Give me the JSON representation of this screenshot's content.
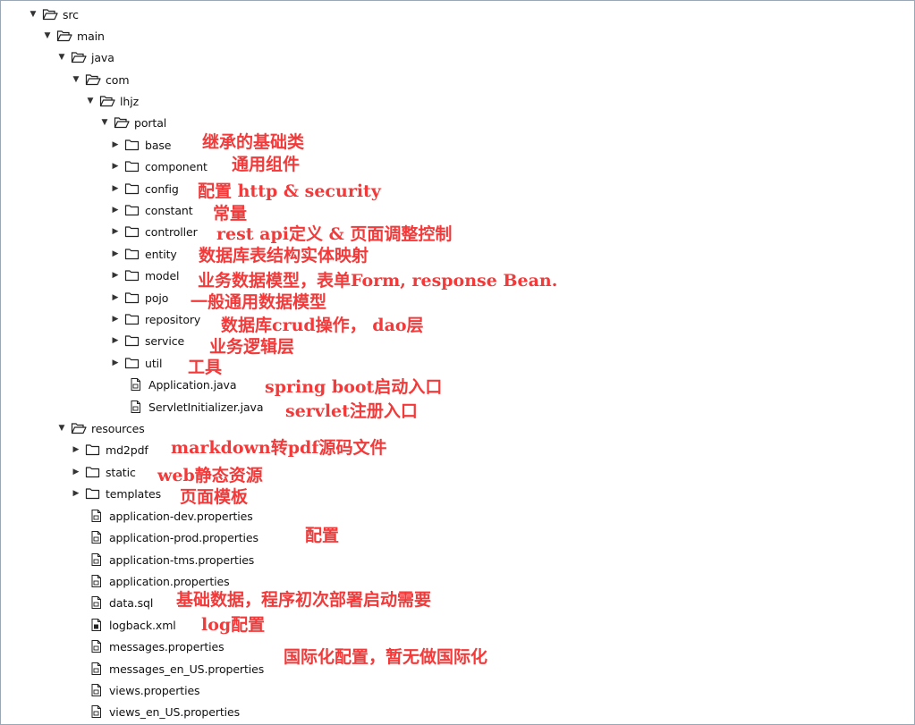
{
  "tree": {
    "src": "src",
    "main": "main",
    "java": "java",
    "com": "com",
    "lhjz": "lhjz",
    "portal": "portal",
    "base": "base",
    "component": "component",
    "config": "config",
    "constant": "constant",
    "controller": "controller",
    "entity": "entity",
    "model": "model",
    "pojo": "pojo",
    "repository": "repository",
    "service": "service",
    "util": "util",
    "application_java": "Application.java",
    "servlet_initializer_java": "ServletInitializer.java",
    "resources": "resources",
    "md2pdf": "md2pdf",
    "static": "static",
    "templates": "templates",
    "application_dev": "application-dev.properties",
    "application_prod": "application-prod.properties",
    "application_tms": "application-tms.properties",
    "application_props": "application.properties",
    "data_sql": "data.sql",
    "logback_xml": "logback.xml",
    "messages_props": "messages.properties",
    "messages_en_us": "messages_en_US.properties",
    "views_props": "views.properties",
    "views_en_us": "views_en_US.properties"
  },
  "notes": {
    "base": "继承的基础类",
    "component": "通用组件",
    "config": "配置 http & security",
    "constant": "常量",
    "controller": "rest api定义 & 页面调整控制",
    "entity": "数据库表结构实体映射",
    "model": "业务数据模型，表单Form, response Bean.",
    "pojo": "一般通用数据模型",
    "repository": "数据库crud操作， dao层",
    "service": "业务逻辑层",
    "util": "工具",
    "application_java": "spring boot启动入口",
    "servlet_initializer": "servlet注册入口",
    "md2pdf": "markdown转pdf源码文件",
    "static": "web静态资源",
    "templates": "页面模板",
    "properties": "配置",
    "data_sql": "基础数据，程序初次部署启动需要",
    "logback": "log配置",
    "messages": "国际化配置，暂无做国际化"
  }
}
